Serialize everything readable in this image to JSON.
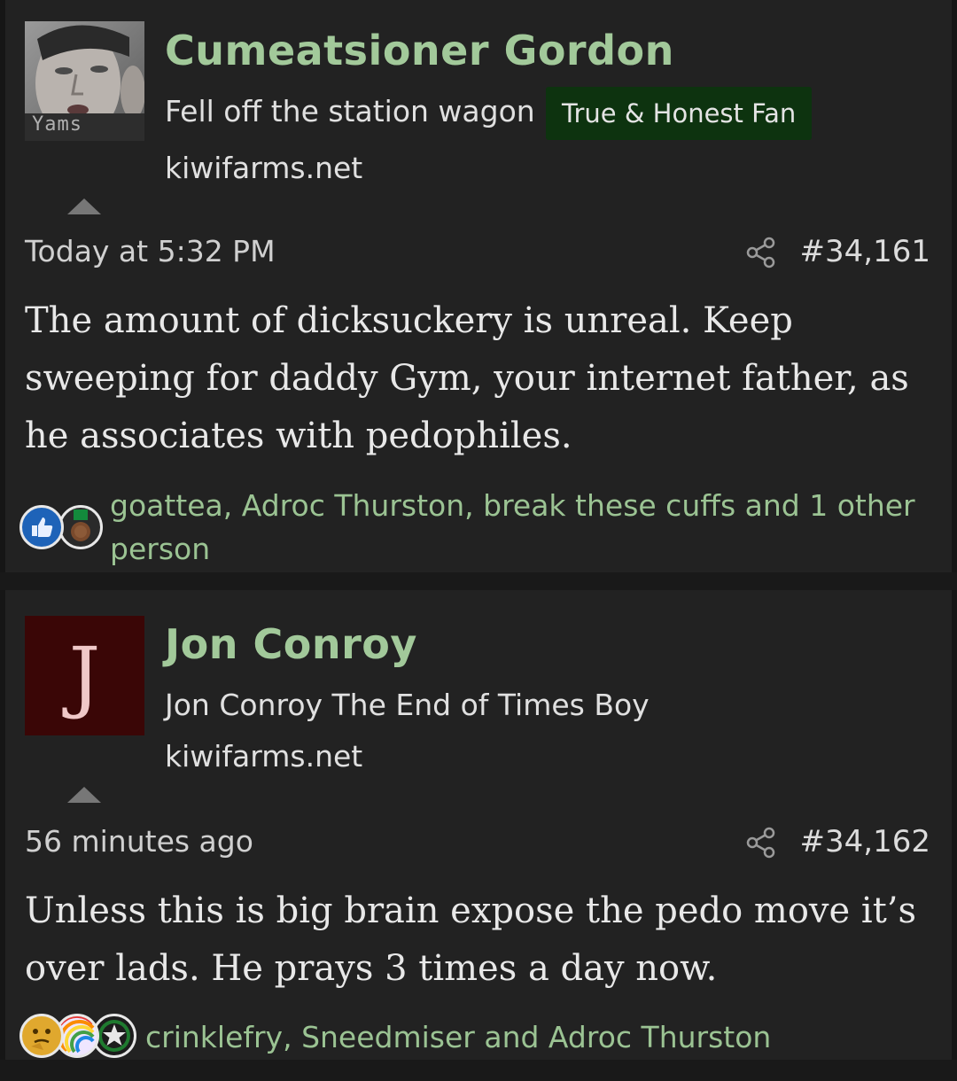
{
  "posts": [
    {
      "username": "Cumeatsioner Gordon",
      "user_title": "Fell off the station wagon",
      "badge": "True & Honest Fan",
      "site": "kiwifarms.net",
      "avatar_caption": "Yams",
      "time": "Today at 5:32 PM",
      "post_number": "#34,161",
      "body": "The amount of dicksuckery is unreal. Keep sweeping for daddy Gym, your internet father, as he associates with pedophiles.",
      "reaction_icons": [
        "thumbs-up-icon",
        "medal-icon"
      ],
      "reactions": "goattea, Adroc Thurston, break these cuffs and 1 other person"
    },
    {
      "username": "Jon Conroy",
      "user_title": "Jon Conroy The End of Times Boy",
      "site": "kiwifarms.net",
      "avatar_letter": "J",
      "time": "56 minutes ago",
      "post_number": "#34,162",
      "body": "Unless this is big brain expose the pedo move it’s over lads. He prays 3 times a day now.",
      "reaction_icons": [
        "thinking-face-icon",
        "rainbow-icon",
        "star-badge-icon"
      ],
      "reactions": "crinklefry, Sneedmiser and Adroc Thurston"
    }
  ],
  "colors": {
    "background": "#161616",
    "post_background": "#222222",
    "username": "#a2c99a",
    "badge_bg": "#0d330f",
    "reaction_link": "#9bc393",
    "avatar_j_bg": "#3a0606",
    "avatar_j_letter": "#f0c8c8"
  }
}
